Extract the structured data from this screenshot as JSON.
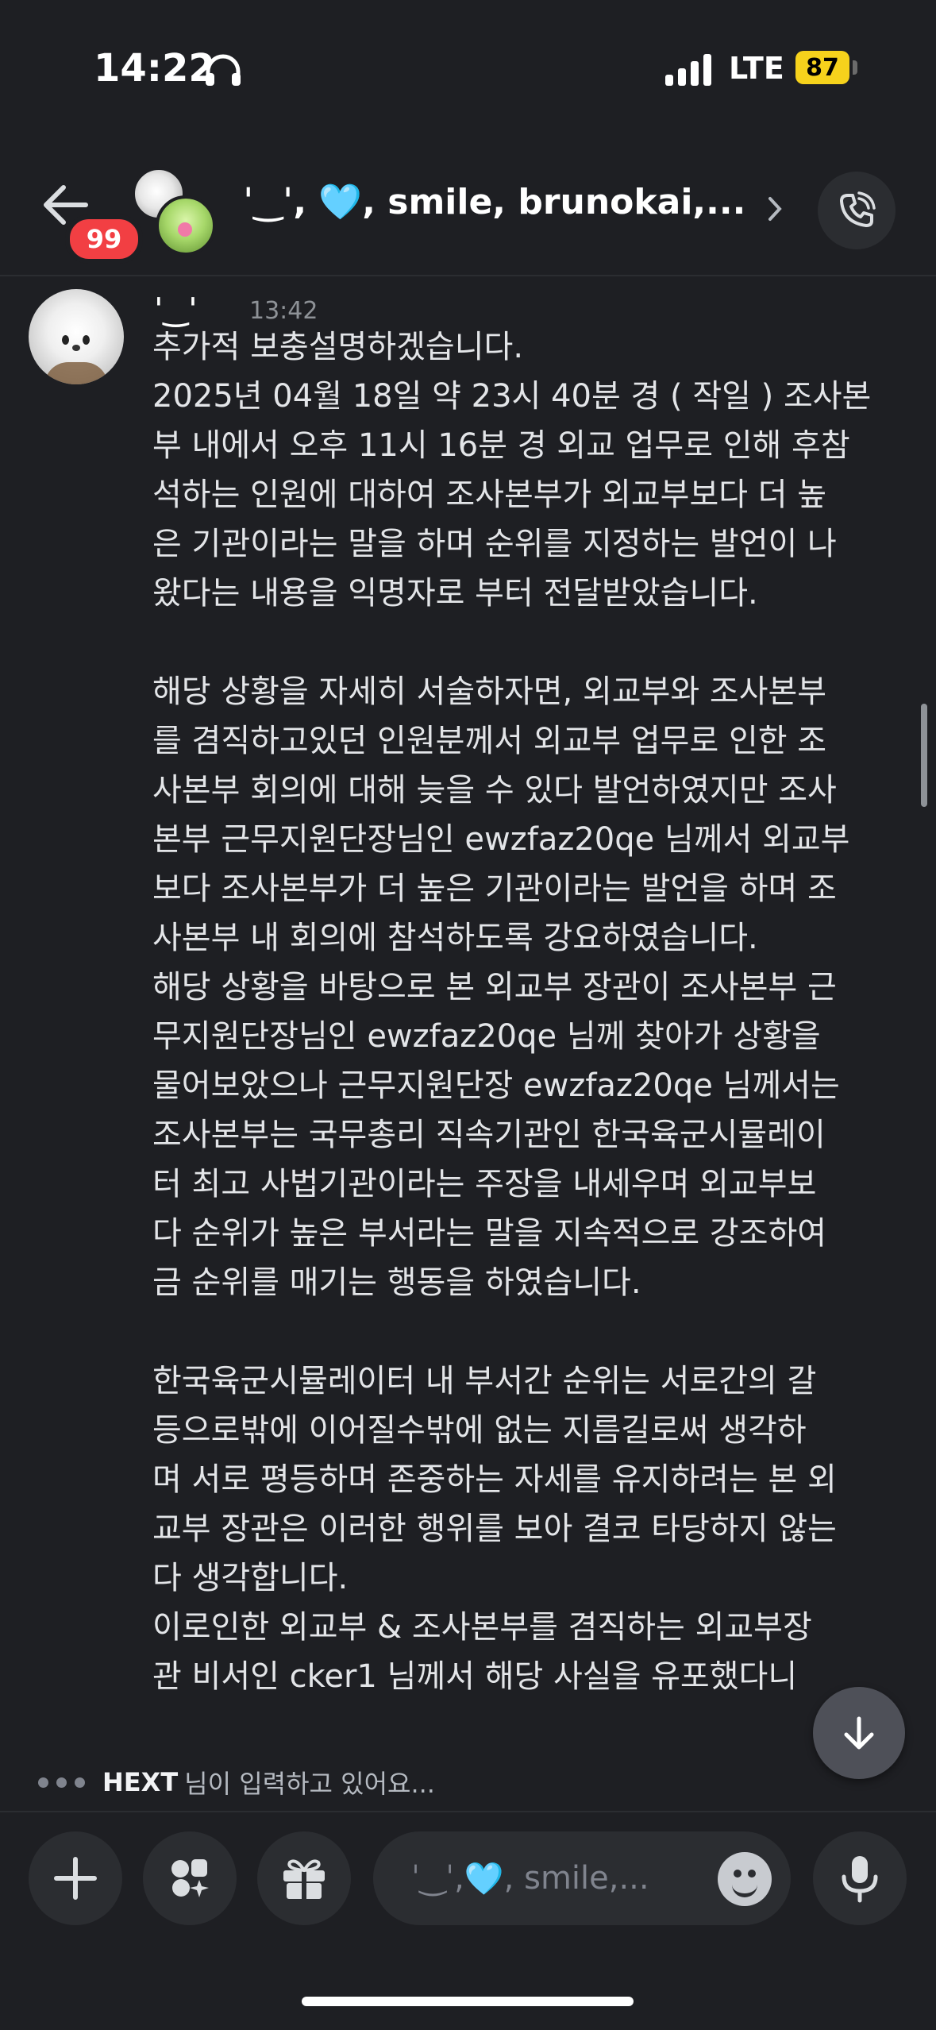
{
  "status_bar": {
    "time": "14:22",
    "network": "LTE",
    "battery": "87",
    "icons": [
      "headphones-icon",
      "signal-icon",
      "battery-icon"
    ]
  },
  "header": {
    "unread_count": "99",
    "title_prefix": "ˈ‿ˈ, ",
    "title_heart": "🩵",
    "title_suffix": ", smile, brunokai,...",
    "icons": [
      "back-arrow-icon",
      "chevron-right-icon",
      "phone-call-icon"
    ]
  },
  "message": {
    "author": "ˈ‿ˈ",
    "time": "13:42",
    "lines": [
      "추가적 보충설명하겠습니다.",
      "2025년 04월 18일 약 23시 40분 경 ( 작일 ) 조사본",
      "부 내에서 오후 11시 16분 경 외교 업무로 인해 후참",
      "석하는 인원에 대하여 조사본부가 외교부보다 더 높",
      "은 기관이라는 말을 하며 순위를 지정하는 발언이 나",
      "왔다는 내용을 익명자로 부터 전달받았습니다.",
      "",
      "해당 상황을 자세히 서술하자면, 외교부와 조사본부",
      "를 겸직하고있던 인원분께서 외교부 업무로 인한 조",
      "사본부 회의에 대해 늦을 수 있다 발언하였지만 조사",
      "본부 근무지원단장님인 ewzfaz20qe 님께서 외교부",
      "보다 조사본부가 더 높은 기관이라는 발언을 하며 조",
      "사본부 내 회의에 참석하도록 강요하였습니다.",
      "해당 상황을 바탕으로 본 외교부 장관이 조사본부 근",
      "무지원단장님인 ewzfaz20qe 님께 찾아가 상황을",
      "물어보았으나 근무지원단장 ewzfaz20qe 님께서는",
      "조사본부는 국무총리 직속기관인 한국육군시뮬레이",
      "터 최고 사법기관이라는 주장을 내세우며 외교부보",
      "다 순위가 높은 부서라는 말을 지속적으로 강조하여",
      "금 순위를 매기는 행동을 하였습니다.",
      "",
      "한국육군시뮬레이터 내 부서간 순위는 서로간의 갈",
      "등으로밖에 이어질수밖에 없는 지름길로써 생각하",
      "며 서로 평등하며 존중하는 자세를 유지하려는 본 외",
      "교부 장관은 이러한 행위를 보아 결코 타당하지 않는",
      "다 생각합니다.",
      "이로인한 외교부 & 조사본부를 겸직하는 외교부장",
      "관 비서인 cker1 님께서 해당 사실을 유포했다니"
    ]
  },
  "typing": {
    "user": "HEXT",
    "text": "님이 입력하고 있어요..."
  },
  "composer": {
    "placeholder_prefix": "ˈ‿ˈ, ",
    "placeholder_heart": "🩵",
    "placeholder_suffix": ", smile,...",
    "icons": [
      "plus-icon",
      "apps-icon",
      "gift-icon",
      "emoji-icon",
      "microphone-icon",
      "arrow-down-icon"
    ]
  }
}
